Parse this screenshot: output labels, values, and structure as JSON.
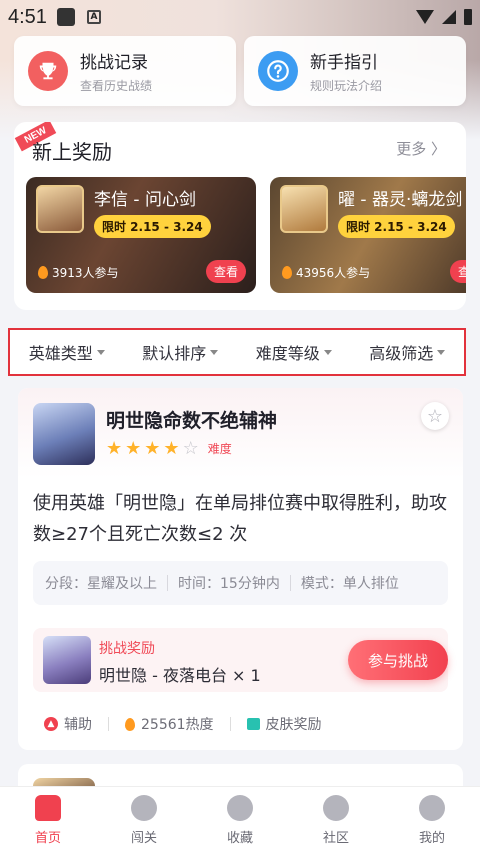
{
  "status": {
    "time": "4:51"
  },
  "quick": [
    {
      "title": "挑战记录",
      "sub": "查看历史战绩",
      "icon": "trophy-icon"
    },
    {
      "title": "新手指引",
      "sub": "规则玩法介绍",
      "icon": "help-icon"
    }
  ],
  "rewards": {
    "tag": "NEW",
    "title": "新上奖励",
    "more": "更多 〉",
    "items": [
      {
        "name": "李信 - 问心剑",
        "limit": "限时 2.15 - 3.24",
        "count": "3913人参与",
        "action": "查看"
      },
      {
        "name": "曜 - 器灵·螭龙剑",
        "limit": "限时 2.15 - 3.24",
        "count": "43956人参与",
        "action": "查看"
      }
    ]
  },
  "filters": [
    "英雄类型",
    "默认排序",
    "难度等级",
    "高级筛选"
  ],
  "challenge": {
    "title": "明世隐命数不绝辅神",
    "difficulty_label": "难度",
    "stars_filled": 4,
    "stars_total": 5,
    "desc": "使用英雄「明世隐」在单局排位赛中取得胜利，助攻数≥27个且死亡次数≤2 次",
    "meta": [
      "分段：星耀及以上",
      "时间：15分钟内",
      "模式：单人排位"
    ],
    "reward_label": "挑战奖励",
    "reward_item": "明世隐 - 夜落电台 × 1",
    "join": "参与挑战",
    "role": "辅助",
    "heat": "25561热度",
    "reward_type": "皮肤奖励"
  },
  "tabs": [
    {
      "label": "首页",
      "icon": "home-icon",
      "active": true
    },
    {
      "label": "闯关",
      "icon": "lightning-icon",
      "active": false
    },
    {
      "label": "收藏",
      "icon": "badge-icon",
      "active": false
    },
    {
      "label": "社区",
      "icon": "compass-icon",
      "active": false
    },
    {
      "label": "我的",
      "icon": "user-icon",
      "active": false
    }
  ],
  "colors": {
    "accent": "#f0414f",
    "filter_border": "#e2323c",
    "star": "#ffb22a",
    "limit_badge": "#ffd23d"
  }
}
